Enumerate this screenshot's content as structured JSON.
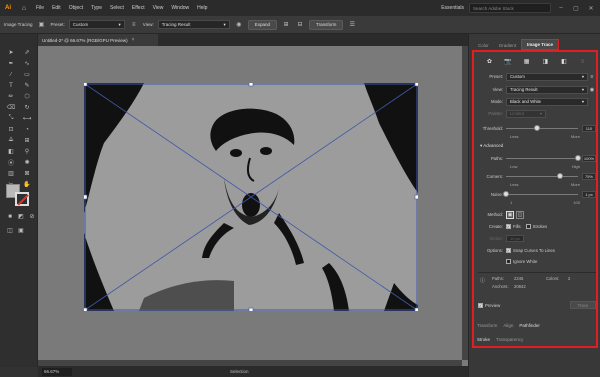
{
  "menubar": {
    "app_logo": "Ai",
    "items": [
      "File",
      "Edit",
      "Object",
      "Type",
      "Select",
      "Effect",
      "View",
      "Window",
      "Help"
    ],
    "workspace": "Essentials",
    "search_placeholder": "Search Adobe Stock"
  },
  "controlbar": {
    "context": "Image Tracing",
    "preset_label": "Preset:",
    "preset_value": "Custom",
    "view_label": "View:",
    "view_value": "Tracing Result",
    "expand_button": "Expand",
    "transform_button": "Transform"
  },
  "document": {
    "tab_title": "Untitled-2* @ 66.67% (RGB/GPU Preview)",
    "close": "×"
  },
  "status": {
    "zoom": "66.67%",
    "tool": "Selection"
  },
  "panel": {
    "tabs": [
      "Color",
      "Gradient",
      "Image Trace"
    ],
    "active_tab": "Image Trace",
    "preset_label": "Preset:",
    "preset_value": "Custom",
    "view_label": "View:",
    "view_value": "Tracing Result",
    "mode_label": "Mode:",
    "mode_value": "Black and White",
    "palette_label": "Palette:",
    "palette_value": "Limited",
    "threshold_label": "Threshold:",
    "threshold_value": "110",
    "threshold_fraction": 0.43,
    "threshold_less": "Less",
    "threshold_more": "More",
    "advanced_label": "Advanced",
    "paths_label": "Paths:",
    "paths_value": "100%",
    "paths_fraction": 1.0,
    "paths_low": "Low",
    "paths_high": "High",
    "corners_label": "Corners:",
    "corners_value": "75%",
    "corners_fraction": 0.75,
    "corners_less": "Less",
    "corners_more": "More",
    "noise_label": "Noise:",
    "noise_value": "1 px",
    "noise_fraction": 0.0,
    "noise_min": "1",
    "noise_max": "100",
    "method_label": "Method:",
    "create_label": "Create:",
    "fills_label": "Fills",
    "fills_checked": true,
    "strokes_label": "Strokes",
    "strokes_checked": false,
    "stroke_label": "Stroke:",
    "stroke_value": "10 px",
    "options_label": "Options:",
    "snap_label": "Snap Curves To Lines",
    "snap_checked": true,
    "ignore_white_label": "Ignore White",
    "ignore_white_checked": false,
    "stat_paths_label": "Paths:",
    "stat_paths_value": "2245",
    "stat_colors_label": "Colors:",
    "stat_colors_value": "2",
    "stat_anchors_label": "Anchors:",
    "stat_anchors_value": "20842",
    "preview_label": "Preview",
    "preview_checked": true,
    "trace_button": "Trace",
    "lower_tabs_1": [
      "Transform",
      "Align",
      "Pathfinder"
    ],
    "lower_tabs_2": [
      "Stroke",
      "Transparency"
    ]
  },
  "colors": {
    "highlight": "#e02020",
    "accent_logo": "#ff9a00"
  }
}
